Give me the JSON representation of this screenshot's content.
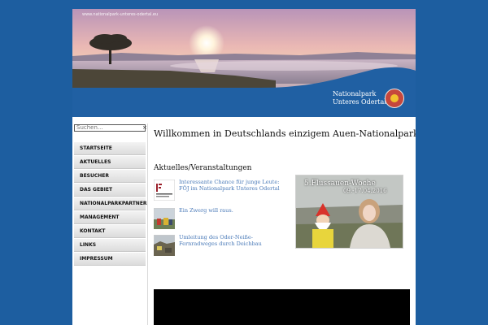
{
  "header": {
    "url": "www.nationalpark-unteres-odertal.eu",
    "title_line1": "Nationalpark",
    "title_line2": "Unteres Odertal"
  },
  "search": {
    "placeholder": "Suchen...",
    "clear": "×"
  },
  "nav": {
    "items": [
      {
        "label": "STARTSEITE"
      },
      {
        "label": "AKTUELLES"
      },
      {
        "label": "BESUCHER"
      },
      {
        "label": "DAS GEBIET"
      },
      {
        "label": "NATIONALPARKPARTNER"
      },
      {
        "label": "MANAGEMENT"
      },
      {
        "label": "KONTAKT"
      },
      {
        "label": "LINKS"
      },
      {
        "label": "IMPRESSUM"
      }
    ]
  },
  "main": {
    "welcome": "Willkommen in Deutschlands einzigem Auen-Nationalpark",
    "section_title": "Aktuelles/Veranstaltungen",
    "news": [
      {
        "title": "Interessante Chance für junge Leute: FÖJ im Nationalpark Unteres Odertal",
        "icon": "foej-logo-thumb"
      },
      {
        "title": "Ein Zwerg will raus.",
        "icon": "gnome-thumb"
      },
      {
        "title": "Umleitung des Oder-Neiße-Fernradweges durch Deichbau",
        "icon": "dike-thumb"
      }
    ],
    "promo": {
      "title": "5.Flussauen-Woche",
      "date": "09.-17.04.2016"
    }
  },
  "colors": {
    "background": "#1d5ea0",
    "link": "#4a7ab8",
    "header_wave": "#2060a3"
  }
}
